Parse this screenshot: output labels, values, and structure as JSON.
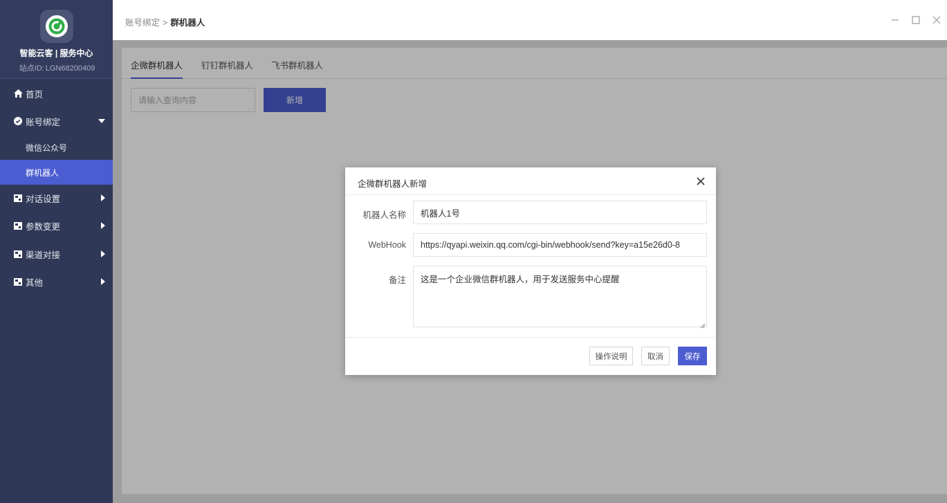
{
  "sidebar": {
    "brand_name": "智能云客 | 服务中心",
    "site_id_label": "站点ID:",
    "site_id_value": "LGN68200409",
    "menu": {
      "home": "首页",
      "account_binding": "账号绑定",
      "wechat_official": "微信公众号",
      "group_robot": "群机器人",
      "dialog_settings": "对话设置",
      "param_change": "参数变更",
      "channel_docking": "渠道对接",
      "other": "其他"
    }
  },
  "topbar": {
    "breadcrumb_parent": "账号绑定",
    "breadcrumb_sep": ">",
    "breadcrumb_current": "群机器人"
  },
  "tabs": {
    "wecom": "企微群机器人",
    "dingtalk": "钉钉群机器人",
    "feishu": "飞书群机器人"
  },
  "toolbar": {
    "search_placeholder": "请输入查询内容",
    "add_label": "新增"
  },
  "modal": {
    "title": "企微群机器人新增",
    "name_label": "机器人名称",
    "name_value": "机器人1号",
    "webhook_label": "WebHook",
    "webhook_value": "https://qyapi.weixin.qq.com/cgi-bin/webhook/send?key=a15e26d0-8",
    "remark_label": "备注",
    "remark_value": "这是一个企业微信群机器人，用于发送服务中心提醒",
    "btn_help": "操作说明",
    "btn_cancel": "取消",
    "btn_save": "保存"
  },
  "colors": {
    "sidebar_bg": "#2f3856",
    "accent": "#4b5dd0",
    "logo_green": "#2fae48"
  },
  "icons": [
    "app-logo-icon",
    "home-icon",
    "check-circle-icon",
    "menu-block-icon",
    "minimize-icon",
    "maximize-icon",
    "close-icon"
  ]
}
